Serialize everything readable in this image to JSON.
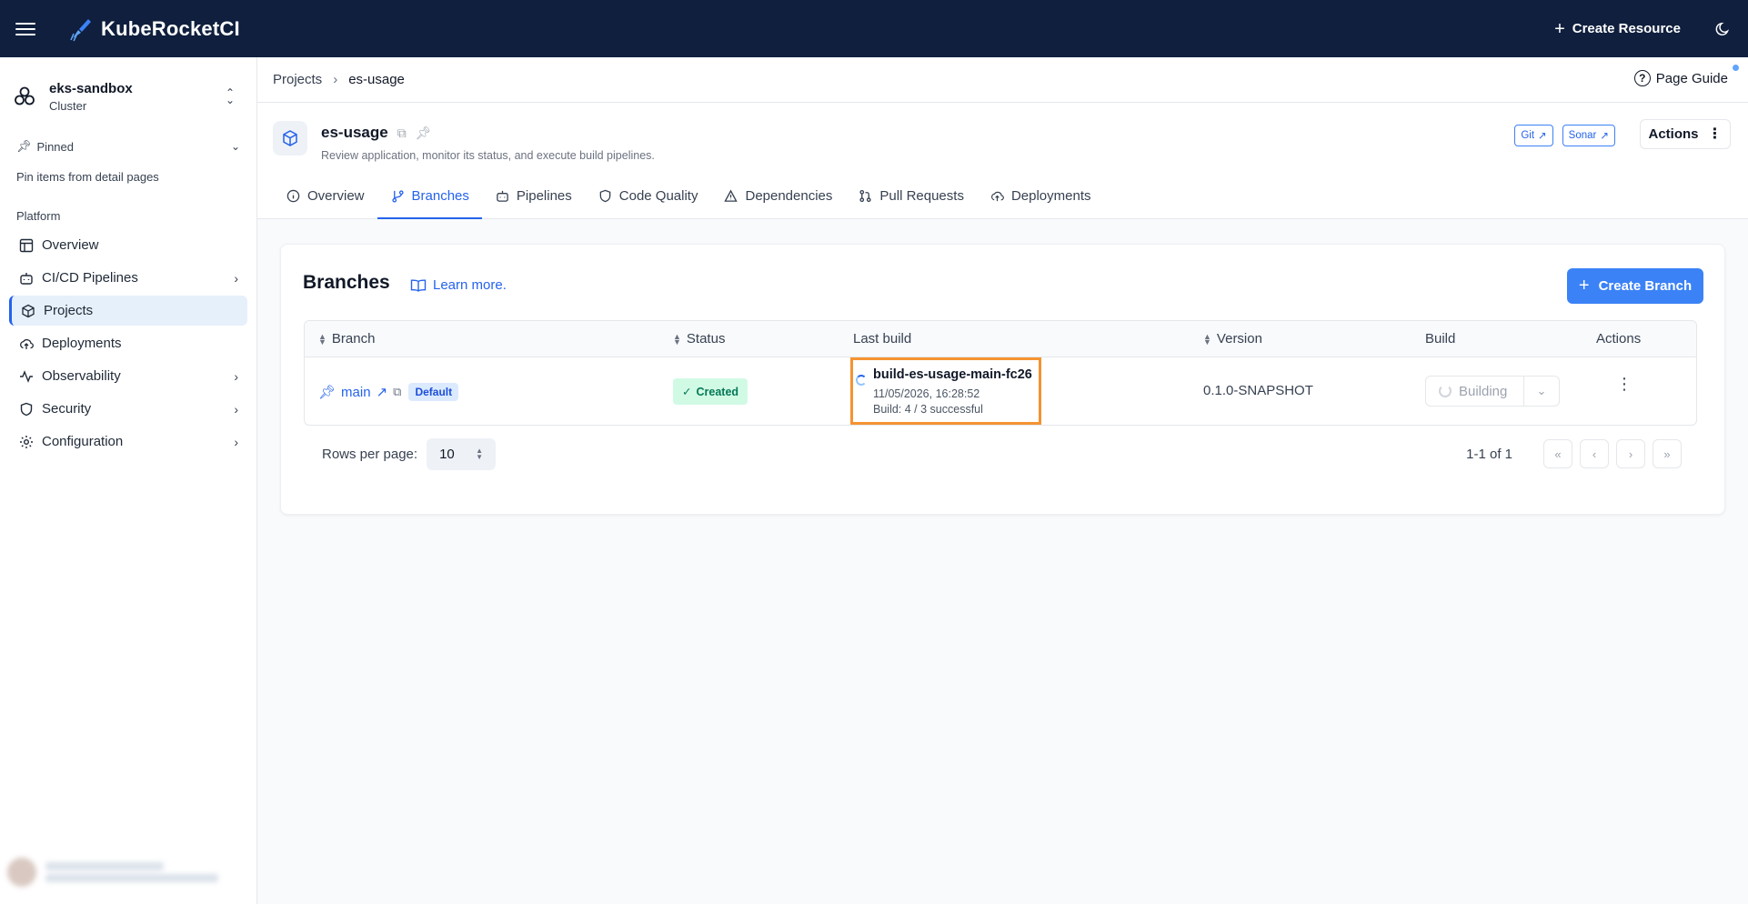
{
  "topbar": {
    "app_name": "KubeRocketCI",
    "create_resource_label": "Create Resource"
  },
  "sidebar": {
    "cluster_name": "eks-sandbox",
    "cluster_sub": "Cluster",
    "pinned_label": "Pinned",
    "pinned_note": "Pin items from detail pages",
    "section_label": "Platform",
    "items": [
      {
        "label": "Overview",
        "icon": "layout-icon",
        "has_children": false
      },
      {
        "label": "CI/CD Pipelines",
        "icon": "bot-icon",
        "has_children": true
      },
      {
        "label": "Projects",
        "icon": "box-icon",
        "has_children": false,
        "active": true
      },
      {
        "label": "Deployments",
        "icon": "cloud-upload-icon",
        "has_children": false
      },
      {
        "label": "Observability",
        "icon": "activity-icon",
        "has_children": true
      },
      {
        "label": "Security",
        "icon": "shield-icon",
        "has_children": true
      },
      {
        "label": "Configuration",
        "icon": "gear-icon",
        "has_children": true
      }
    ]
  },
  "breadcrumb": {
    "root": "Projects",
    "current": "es-usage"
  },
  "page_guide_label": "Page Guide",
  "project": {
    "name": "es-usage",
    "description": "Review application, monitor its status, and execute build pipelines.",
    "links": [
      "Git",
      "Sonar"
    ],
    "actions_label": "Actions"
  },
  "tabs": [
    {
      "label": "Overview",
      "icon": "info-icon"
    },
    {
      "label": "Branches",
      "icon": "git-branch-icon",
      "active": true
    },
    {
      "label": "Pipelines",
      "icon": "bot-icon"
    },
    {
      "label": "Code Quality",
      "icon": "shield-icon"
    },
    {
      "label": "Dependencies",
      "icon": "alert-triangle-icon"
    },
    {
      "label": "Pull Requests",
      "icon": "git-pull-request-icon"
    },
    {
      "label": "Deployments",
      "icon": "cloud-upload-icon"
    }
  ],
  "branches": {
    "title": "Branches",
    "learn_more": "Learn more.",
    "create_label": "Create Branch",
    "columns": [
      "Branch",
      "Status",
      "Last build",
      "Version",
      "Build",
      "Actions"
    ],
    "rows": [
      {
        "branch": "main",
        "badge": "Default",
        "status": "Created",
        "last_build_name": "build-es-usage-main-fc26",
        "last_build_date": "11/05/2026, 16:28:52",
        "last_build_count": "Build: 4 / 3 successful",
        "version": "0.1.0-SNAPSHOT",
        "build_state": "Building"
      }
    ],
    "rows_per_page_label": "Rows per page:",
    "rows_per_page": "10",
    "range": "1-1 of 1"
  },
  "colors": {
    "topbar": "#0f1f3d",
    "accent": "#3b82f6",
    "highlight": "#f59332",
    "status_ok": "#047857"
  }
}
